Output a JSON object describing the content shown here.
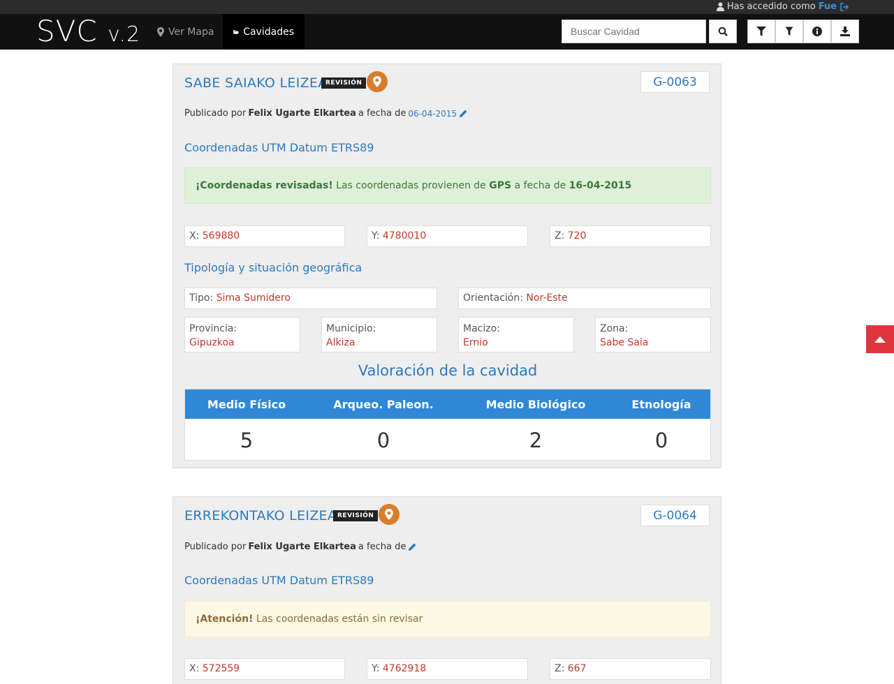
{
  "topbar": {
    "logged_in_text": "Has accedido como",
    "username": "Fue"
  },
  "navbar": {
    "brand": "SVC",
    "brand_version": "v.2",
    "nav_map": "Ver Mapa",
    "nav_caves": "Cavidades",
    "search_placeholder": "Buscar Cavidad",
    "icons": [
      "search-icon",
      "filter-icon",
      "filter-outline-icon",
      "info-icon",
      "download-icon"
    ]
  },
  "colors": {
    "navbar": "#111111",
    "accent": "#2a7abf",
    "value_red": "#c0392b",
    "badge": "#222222",
    "pin": "#d97d2a",
    "table_header": "#2f87d6",
    "scroll_top": "#e0363f"
  },
  "caves": [
    {
      "title": "SABE SAIAKO LEIZEA",
      "badge": "REVISIÓN",
      "code": "G-0063",
      "published_prefix": "Publicado por",
      "author": "Felix Ugarte Elkartea",
      "date_prefix": "a fecha de",
      "date": "06-04-2015",
      "coords_title": "Coordenadas UTM Datum ETRS89",
      "alert_strong": "¡Coordenadas revisadas!",
      "alert_text_1": "Las coordenadas provienen de",
      "alert_source": "GPS",
      "alert_text_2": "a fecha de",
      "alert_date": "16-04-2015",
      "x_label": "X:",
      "x": "569880",
      "y_label": "Y:",
      "y": "4780010",
      "z_label": "Z:",
      "z": "720",
      "typology_title": "Tipología y situación geográfica",
      "tipo_label": "Tipo:",
      "tipo": "Sima Sumidero",
      "orient_label": "Orientación:",
      "orient": "Nor-Este",
      "provincia_label": "Provincia:",
      "provincia": "Gipuzkoa",
      "municipio_label": "Municipio:",
      "municipio": "Alkiza",
      "macizo_label": "Macizo:",
      "macizo": "Ernio",
      "zona_label": "Zona:",
      "zona": "Sabe Saia",
      "valuation_title": "Valoración de la cavidad",
      "valuation_headers": [
        "Medio Físico",
        "Arqueo. Paleon.",
        "Medio Biológico",
        "Etnología"
      ],
      "valuation_values": [
        "5",
        "0",
        "2",
        "0"
      ]
    },
    {
      "title": "ERREKONTAKO LEIZEA",
      "badge": "REVISIÓN",
      "code": "G-0064",
      "published_prefix": "Publicado por",
      "author": "Felix Ugarte Elkartea",
      "date_prefix": "a fecha de",
      "coords_title": "Coordenadas UTM Datum ETRS89",
      "alert_strong": "¡Atención!",
      "alert_text_1": "Las coordenadas están sin revisar",
      "x_label": "X:",
      "x": "572559",
      "y_label": "Y:",
      "y": "4762918",
      "z_label": "Z:",
      "z": "667"
    }
  ]
}
